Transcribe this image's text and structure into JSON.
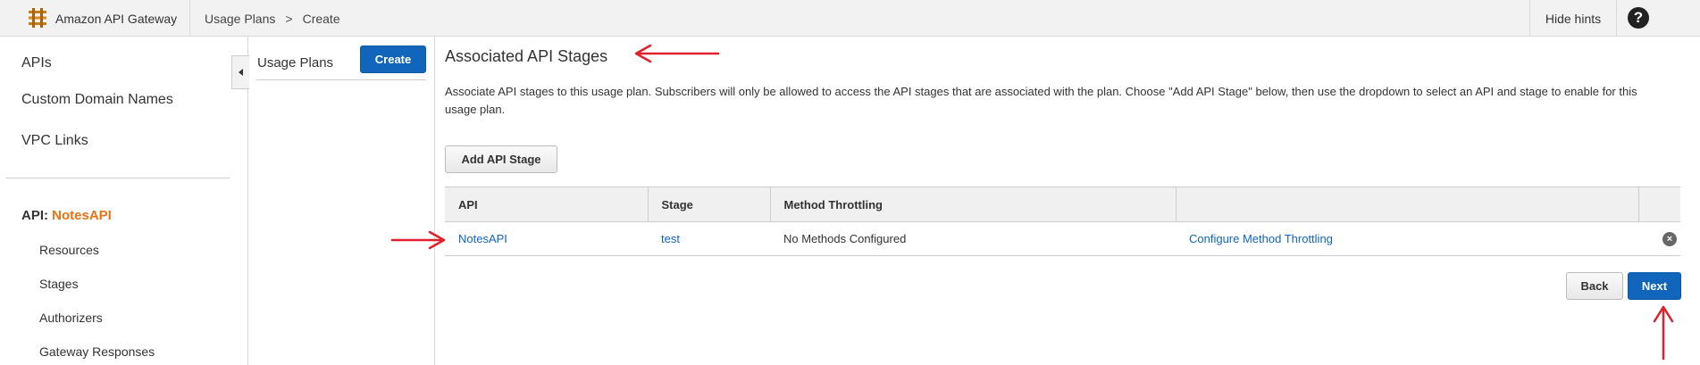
{
  "header": {
    "brand_title": "Amazon API Gateway",
    "breadcrumbs": [
      "Usage Plans",
      "Create"
    ],
    "breadcrumb_separator": ">",
    "hide_hints_label": "Hide hints",
    "help_label": "?"
  },
  "sidebar": {
    "items": [
      {
        "label": "APIs"
      },
      {
        "label": "Custom Domain Names"
      },
      {
        "label": "VPC Links"
      }
    ],
    "api_prefix": "API:",
    "api_name": "NotesAPI",
    "api_items": [
      {
        "label": "Resources"
      },
      {
        "label": "Stages"
      },
      {
        "label": "Authorizers"
      },
      {
        "label": "Gateway Responses"
      }
    ]
  },
  "plans_panel": {
    "label": "Usage Plans",
    "create_label": "Create"
  },
  "main": {
    "title": "Associated API Stages",
    "description": "Associate API stages to this usage plan. Subscribers will only be allowed to access the API stages that are associated with the plan. Choose \"Add API Stage\" below, then use the dropdown to select an API and stage to enable for this usage plan.",
    "add_stage_label": "Add API Stage",
    "table": {
      "columns": [
        "API",
        "Stage",
        "Method Throttling",
        "",
        ""
      ],
      "rows": [
        {
          "api": "NotesAPI",
          "stage": "test",
          "throttling": "No Methods Configured",
          "configure": "Configure Method Throttling",
          "remove_icon": "remove-icon"
        }
      ]
    },
    "back_label": "Back",
    "next_label": "Next"
  },
  "colors": {
    "accent_blue": "#1166bb",
    "api_name_orange": "#ec7211",
    "annotation_red": "#e0202a"
  }
}
